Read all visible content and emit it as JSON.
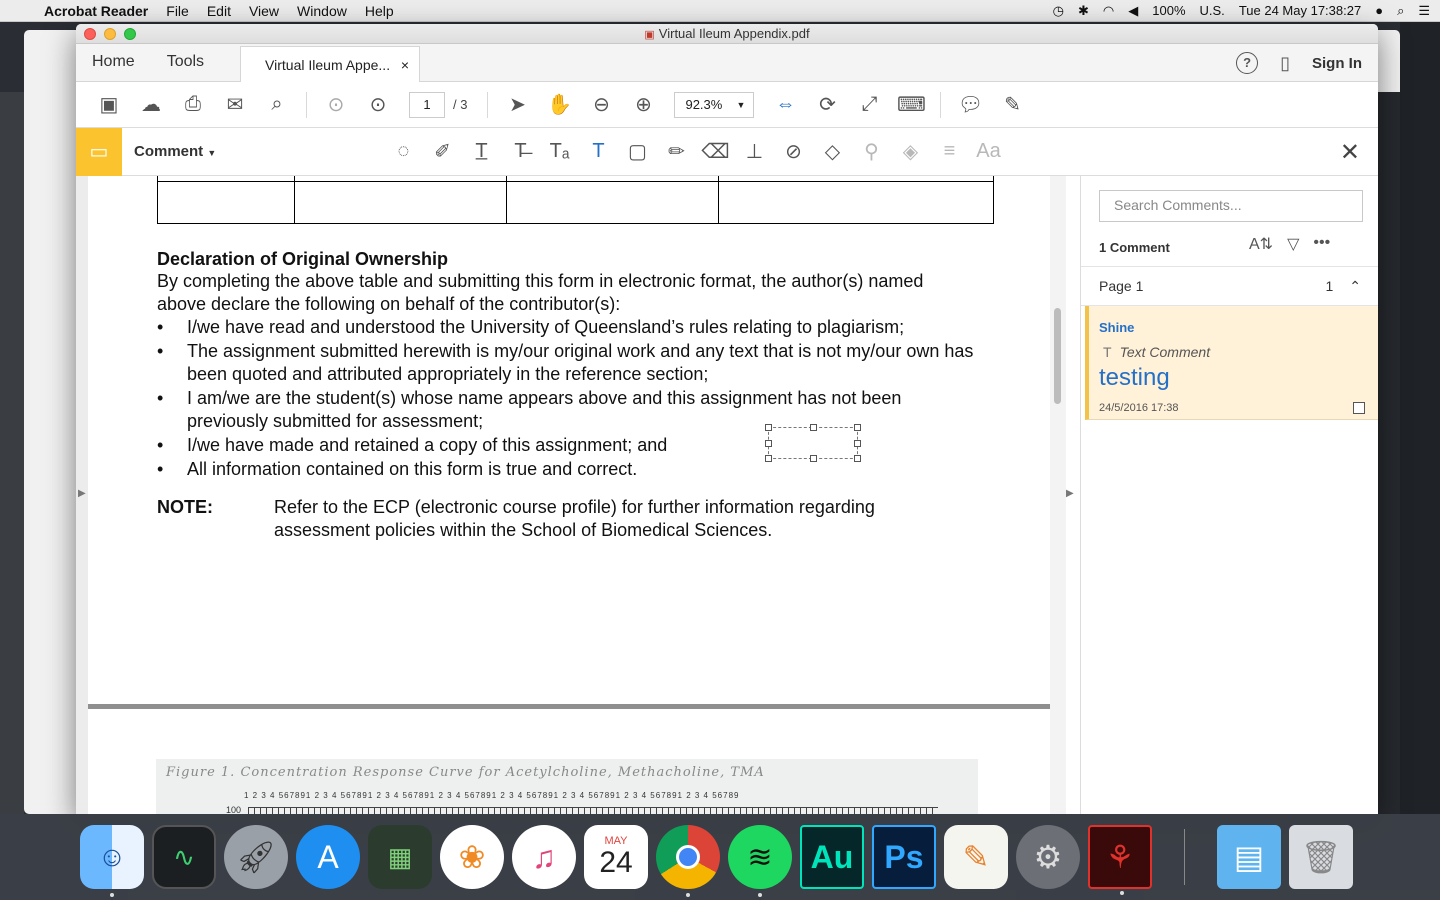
{
  "menubar": {
    "app_name": "Acrobat Reader",
    "items": [
      "File",
      "Edit",
      "View",
      "Window",
      "Help"
    ],
    "battery": "100%",
    "input_source": "U.S.",
    "clock": "Tue 24 May  17:38:27"
  },
  "window": {
    "title": "Virtual Ileum Appendix.pdf",
    "nav": {
      "home": "Home",
      "tools": "Tools"
    },
    "tab_label": "Virtual Ileum Appe...",
    "tab_close": "×",
    "help": "?",
    "sign_in": "Sign In"
  },
  "toolbar": {
    "page_current": "1",
    "page_total": "/ 3",
    "zoom": "92.3%"
  },
  "comment_toolbar": {
    "label": "Comment",
    "close": "✕",
    "font_tool": "Aa"
  },
  "document": {
    "declaration_title": "Declaration of Original Ownership",
    "declaration_intro": "By completing the above table and submitting this form in electronic format, the author(s) named above declare the following on behalf of the contributor(s):",
    "bullets": [
      "I/we have read and understood the University of Queensland’s rules relating to plagiarism;",
      "The assignment submitted herewith is my/our original work and any text that is not my/our own has been quoted and attributed appropriately in the reference section;",
      "I am/we are the student(s) whose name appears above and this assignment has not been previously submitted for assessment;",
      "I/we have made and retained a copy of this assignment; and",
      "All information contained on this form is true and correct."
    ],
    "note_label": "NOTE:",
    "note_text": "Refer to the ECP (electronic course profile) for further information regarding assessment policies within the School of Biomedical Sciences.",
    "figure_caption": "Figure 1.  Concentration Response Curve for Acetylcholine, Methacholine, TMA",
    "figure_ticks": "1   2  3  4 567891    2  3  4 567891    2  3  4 567891    2  3  4 567891    2  3  4 567891    2  3  4 567891    2  3  4 567891    2  3  4 56789",
    "figure_axis": "100"
  },
  "comment_pane": {
    "search_placeholder": "Search Comments...",
    "comment_count": "1 Comment",
    "page_label": "Page 1",
    "page_count": "1",
    "comment": {
      "author": "Shine",
      "type": "Text Comment",
      "body": "testing",
      "date": "24/5/2016  17:38"
    }
  },
  "dock": {
    "calendar_month": "MAY",
    "calendar_day": "24",
    "apps": [
      "Finder",
      "Activity Monitor",
      "Launchpad",
      "App Store",
      "Image Capture",
      "Photos",
      "iTunes",
      "Calendar",
      "Chrome",
      "Spotify",
      "Audition",
      "Photoshop",
      "Pages",
      "System Preferences",
      "Acrobat Reader",
      "Downloads",
      "Trash"
    ],
    "audition_label": "Au",
    "photoshop_label": "Ps"
  },
  "colors": {
    "accent_blue": "#2470c9",
    "comment_yellow": "#fbc32e",
    "comment_card_bg": "#fff2d9"
  }
}
